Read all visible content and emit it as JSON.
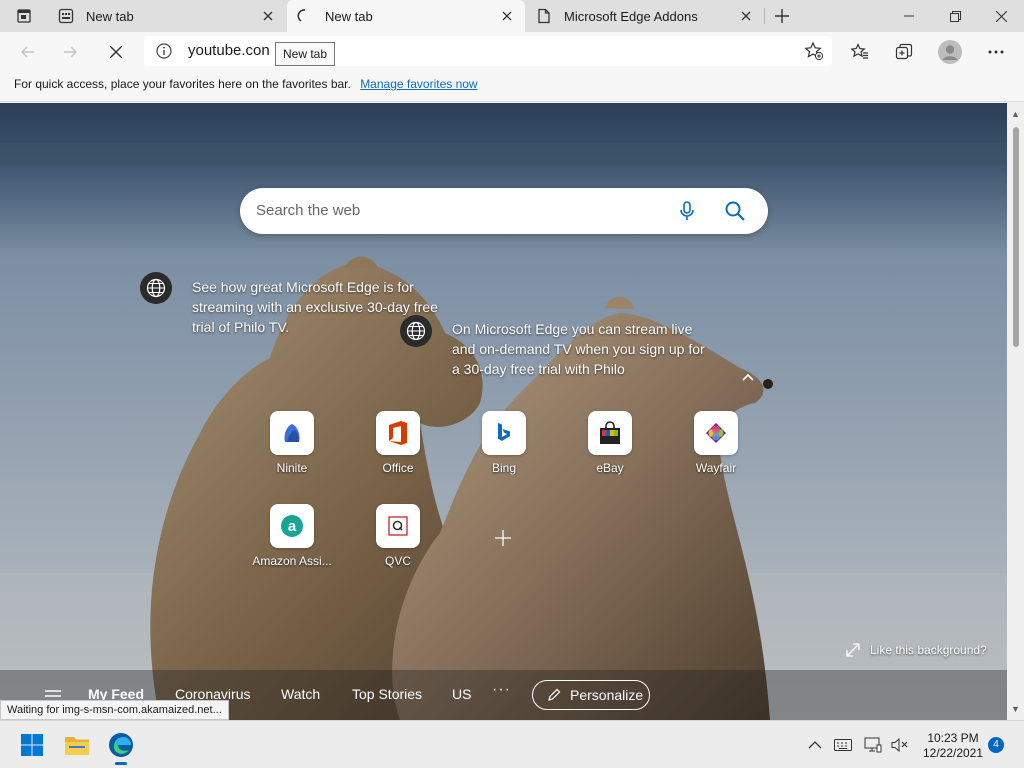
{
  "browser": {
    "tabs": [
      {
        "title": "New tab",
        "active": false
      },
      {
        "title": "New tab",
        "active": true,
        "loading": true
      },
      {
        "title": "Microsoft Edge Addons",
        "active": false
      }
    ],
    "address": {
      "url": "youtube.con"
    },
    "tooltip": "New tab",
    "favorites_hint": {
      "text": "For quick access, place your favorites here on the favorites bar.",
      "link": "Manage favorites now"
    }
  },
  "newtab": {
    "search": {
      "placeholder": "Search the web"
    },
    "promos": [
      {
        "lines": [
          "See how great Microsoft Edge is for",
          "streaming with an exclusive 30-day free",
          "trial of Philo TV."
        ]
      },
      {
        "lines": [
          "On Microsoft Edge you can stream live",
          "and on-demand TV when you sign up for",
          "a 30-day free trial with Philo"
        ]
      }
    ],
    "tiles": [
      {
        "label": "Ninite",
        "icon": "ninite-icon"
      },
      {
        "label": "Office",
        "icon": "office-icon"
      },
      {
        "label": "Bing",
        "icon": "bing-icon"
      },
      {
        "label": "eBay",
        "icon": "ebay-icon"
      },
      {
        "label": "Wayfair",
        "icon": "wayfair-icon"
      },
      {
        "label": "Amazon Assi...",
        "icon": "amazon-icon"
      },
      {
        "label": "QVC",
        "icon": "qvc-icon"
      }
    ],
    "like_background": "Like this background?",
    "feed": {
      "items": [
        "My Feed",
        "Coronavirus",
        "Watch",
        "Top Stories",
        "US"
      ],
      "more": "···",
      "personalize": "Personalize"
    },
    "status": "Waiting for img-s-msn-com.akamaized.net..."
  },
  "taskbar": {
    "time": "10:23 PM",
    "date": "12/22/2021",
    "notifications": "4"
  },
  "colors": {
    "accent": "#0067c0",
    "link": "#0f6cbd"
  }
}
